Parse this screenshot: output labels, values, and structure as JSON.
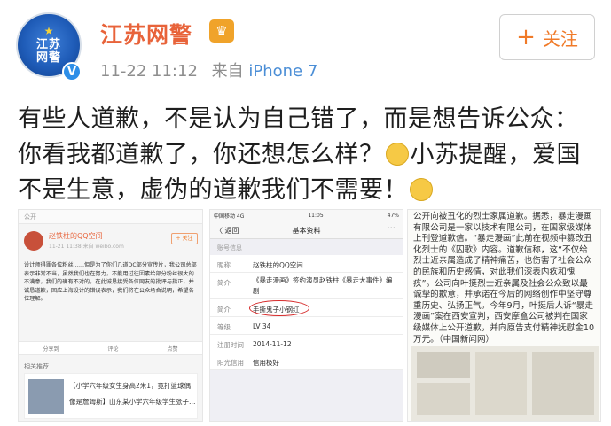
{
  "header": {
    "name": "江苏网警",
    "timestamp": "11-22 11:12",
    "source_prefix": "来自",
    "source_device": "iPhone 7",
    "follow_label": "关注",
    "avatar_lines": [
      "江苏",
      "网警"
    ]
  },
  "post": {
    "text_part1": "有些人道歉，不是认为自己错了，而是想告诉公众：你看我都道歉了，你还想怎么样？",
    "text_part2": "小苏提醒，爱国不是生意，虚伪的道歉我们不需要！"
  },
  "image1": {
    "top_bar": "公开",
    "username": "赵铁柱的QQ空间",
    "subline": "11-21 11:38  来自 weibo.com",
    "follow": "+ 关注",
    "body": "设计师得罪各位粉丝……但是为了你们几道DC部分宣传片，我公司总部表示非常不当，虽然我们也在努力，不能用过往因素给部分粉丝很大的不满意，我们的确有不对的。在此诚恳接受各位网友的批评与指正，并诚恳道歉，回应上海设计的错误表示，我们将在公众场合说明，希望各位理解。",
    "actions": [
      "分享到",
      "评论",
      "点赞"
    ],
    "related_header": "相关推荐",
    "related": [
      "【小学六年级女生身高2米1，竟打篮球偶",
      "像是詹姆斯】山东某小学六年级学生张子…"
    ]
  },
  "image2": {
    "carrier": "中国移动  4G",
    "clock": "11:05",
    "battery": "47%",
    "back_label": "〈 返回",
    "title": "基本资料",
    "more": "···",
    "section": "账号信息",
    "rows": [
      {
        "key": "昵称",
        "value": "赵铁柱的QQ空间"
      },
      {
        "key": "简介",
        "value": "《暴走漫画》签约演员赵铁柱《暴走大事件》编剧"
      },
      {
        "key": "简介",
        "value": "手撕鬼子小钢红"
      },
      {
        "key": "等级",
        "value": "LV 34"
      },
      {
        "key": "注册时间",
        "value": "2014-11-12"
      },
      {
        "key": "阳光信用",
        "value": "信用极好"
      }
    ]
  },
  "image3": {
    "text": "公开向被丑化的烈士家属道歉。据悉，暴走漫画有限公司是一家以技术有限公司，在国家级媒体上刊登道歉信。“暴走漫画”此前在视频中篡改丑化烈士的《囚歌》内容。道歉信称，这“不仅给烈士近亲属造成了精神痛苦，也伤害了社会公众的民族和历史感情，对此我们深表内疚和愧疚”。公司向叶挺烈士近亲属及社会公众致以最诚挚的歉意，并承诺在今后的网络创作中坚守尊重历史、弘扬正气。今年9月，叶挺后人诉“暴走漫画”案在西安宣判，西安摩盒公司被判在国家级媒体上公开道歉，并向原告支付精神抚慰金10万元。（中国新闻网）"
  },
  "colors": {
    "name": "#e8633a",
    "follow": "#f07a28",
    "source": "#4b8ed6",
    "meta": "#8e8e8e",
    "red_circle": "#d62c2c"
  }
}
